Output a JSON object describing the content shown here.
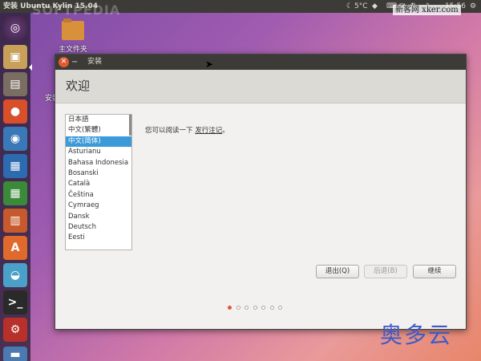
{
  "top_panel": {
    "title": "安装 Ubuntu Kylin 15.04",
    "watermark": "SOFTPEDIA",
    "temperature": "5°C",
    "clock": "15:56",
    "watermark_site": "新客网 xker.com"
  },
  "desktop": {
    "home_folder_label": "主文件夹",
    "install_label": "安装"
  },
  "window": {
    "title": "安装",
    "header_title": "欢迎",
    "languages": [
      "日本語",
      "中文(繁體)",
      "中文(简体)",
      "Asturianu",
      "Bahasa Indonesia",
      "Bosanski",
      "Català",
      "Čeština",
      "Cymraeg",
      "Dansk",
      "Deutsch",
      "Eesti"
    ],
    "selected_language": "中文(简体)",
    "release_notes_prefix": "您可以阅读一下",
    "release_notes_link": "发行注记",
    "release_notes_suffix": "。",
    "buttons": {
      "quit": "退出(Q)",
      "back": "后退(B)",
      "continue": "继续"
    },
    "progress": {
      "total_steps": 7,
      "current_step": 1
    }
  },
  "watermark_bottom": "奥多云",
  "colors": {
    "accent": "#e05a30",
    "selection": "#3d9ad8",
    "panel": "#3c3b37"
  }
}
